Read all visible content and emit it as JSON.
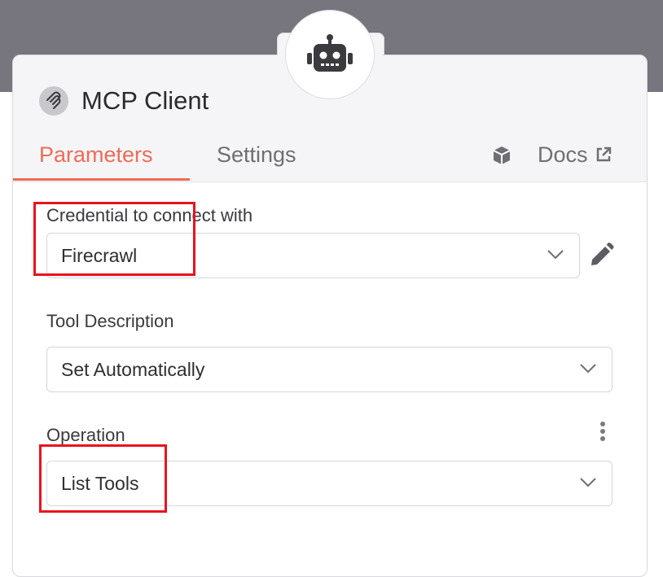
{
  "node": {
    "title": "MCP Client",
    "node_icon": "robot-icon",
    "title_icon": "mcp-logo-icon"
  },
  "tabs": [
    {
      "label": "Parameters",
      "active": true
    },
    {
      "label": "Settings",
      "active": false
    }
  ],
  "docs": {
    "label": "Docs",
    "icon": "external-link-icon",
    "extra_icon": "package-cube-icon"
  },
  "fields": {
    "credential": {
      "label": "Credential to connect with",
      "value": "Firecrawl",
      "edit_icon": "pencil-icon"
    },
    "tool_description": {
      "label": "Tool Description",
      "value": "Set Automatically"
    },
    "operation": {
      "label": "Operation",
      "value": "List Tools",
      "menu_icon": "more-vertical-icon"
    }
  },
  "colors": {
    "accent": "#ef6c55",
    "highlight_box": "#e8141c",
    "backdrop": "#77757e"
  }
}
